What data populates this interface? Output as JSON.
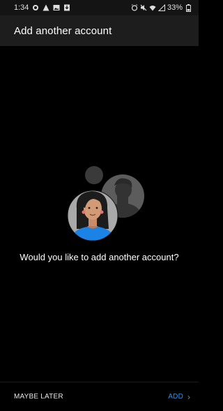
{
  "status_bar": {
    "time": "1:34",
    "battery": "33%",
    "left_icons": [
      "whatsapp-icon",
      "alert-icon",
      "image-icon",
      "download-icon"
    ],
    "right_icons": [
      "alarm-icon",
      "mute-icon",
      "wifi-icon",
      "signal-icon",
      "battery-icon"
    ]
  },
  "app_bar": {
    "title": "Add another account"
  },
  "main": {
    "prompt": "Would you like to add another account?"
  },
  "actions": {
    "maybe_later": "MAYBE LATER",
    "add": "ADD"
  },
  "colors": {
    "accent": "#2f8fe8",
    "background": "#000000",
    "app_bar": "#1d1d1d"
  }
}
